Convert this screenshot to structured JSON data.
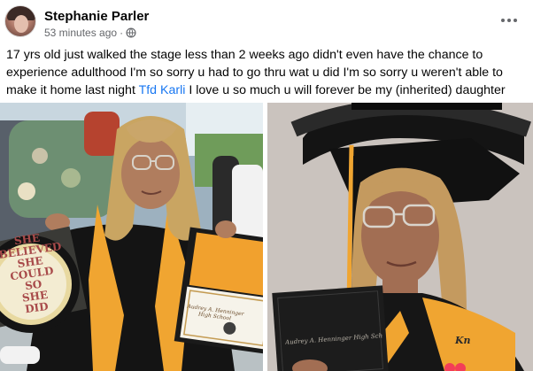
{
  "post": {
    "author": "Stephanie Parler",
    "timestamp": "53 minutes ago",
    "separator": "·",
    "audience_icon": "globe-icon",
    "more_icon": "more-options-icon",
    "text_before_tag": "17 yrs old just walked the stage less than 2 weeks ago didn't even have the chance to experience adulthood I'm so sorry u had to go thru wat u did I'm so sorry u weren't able to make it home last night ",
    "tag": "Tfd Karli",
    "text_after_tag": " I love u so much u will forever be my (inherited) daughter"
  },
  "photos": {
    "left": {
      "cap_text": [
        "SHE",
        "BELIEVED",
        "SHE COULD",
        "SO",
        "SHE",
        "DID"
      ],
      "diploma_text": "Audrey A. Henninger High School"
    },
    "right": {
      "diploma_text": "Audrey A. Henninger High School",
      "stole_text": "Kn"
    }
  },
  "colors": {
    "link": "#1877f2",
    "secondary_text": "#65676b",
    "gown_orange": "#f0a531",
    "gown_black": "#141414"
  }
}
